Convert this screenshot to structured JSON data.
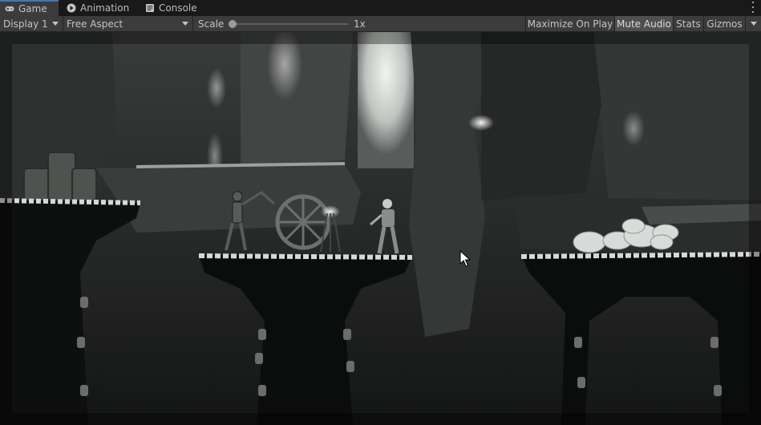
{
  "tabs": [
    {
      "label": "Game",
      "icon": "gamepad-icon",
      "active": true
    },
    {
      "label": "Animation",
      "icon": "animation-icon",
      "active": false
    },
    {
      "label": "Console",
      "icon": "console-icon",
      "active": false
    }
  ],
  "toolbar": {
    "display": "Display 1",
    "aspect": "Free Aspect",
    "scale_label": "Scale",
    "scale_value": "1x",
    "scale_fraction": 0,
    "maximize_on_play": "Maximize On Play",
    "mute_audio": "Mute Audio",
    "stats": "Stats",
    "gizmos": "Gizmos"
  },
  "colors": {
    "editor_bg": "#191919",
    "toolbar_bg": "#3c3c3c",
    "accent": "#3a79bb",
    "scene_dark": "#0d0e0e",
    "scene_stone": "#d7d9d7"
  },
  "game_view": {
    "scene": "2D side-scrolling cave platformer",
    "icons": [
      "cursor-icon"
    ]
  }
}
